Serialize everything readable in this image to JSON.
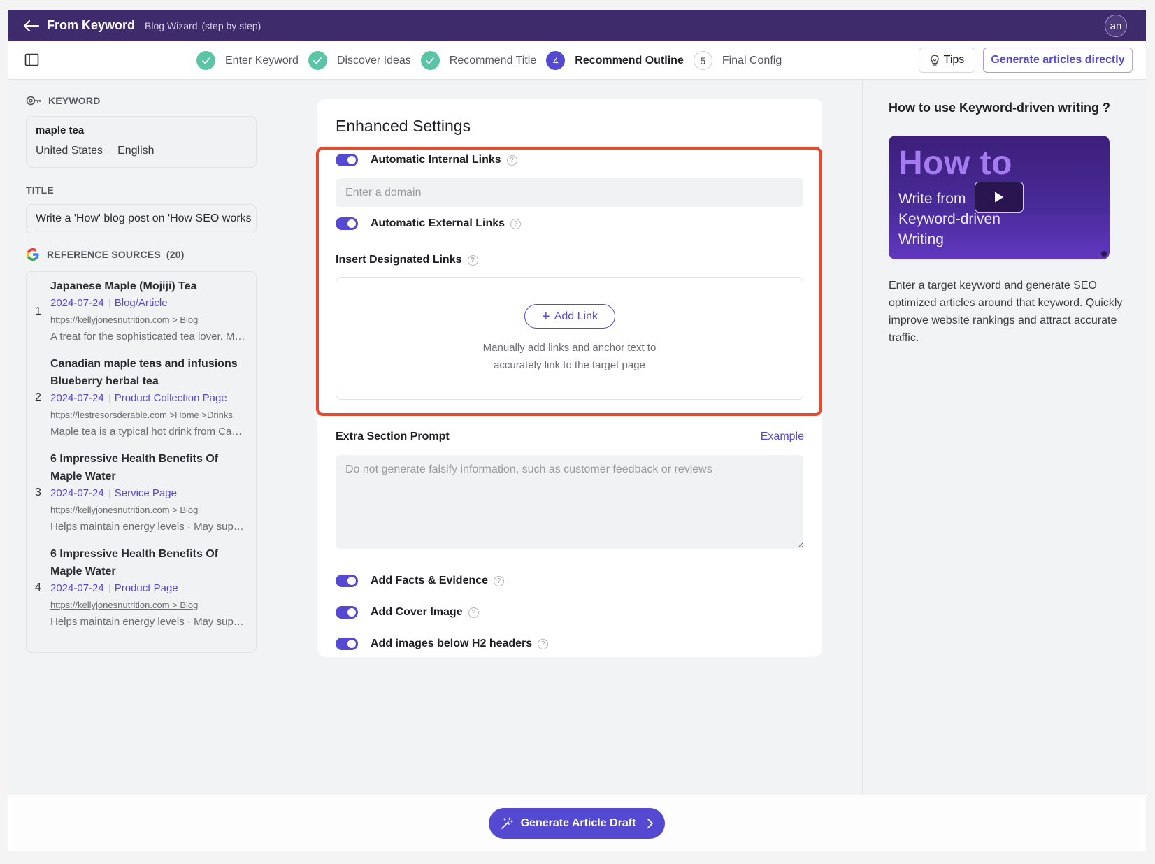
{
  "header": {
    "title": "From Keyword",
    "subtitle": "Blog Wizard",
    "subtitle_note": "(step by step)",
    "avatar_initials": "an"
  },
  "steps": [
    {
      "number": "1",
      "label": "Enter Keyword",
      "status": "done"
    },
    {
      "number": "2",
      "label": "Discover Ideas",
      "status": "done"
    },
    {
      "number": "3",
      "label": "Recommend Title",
      "status": "done"
    },
    {
      "number": "4",
      "label": "Recommend Outline",
      "status": "active"
    },
    {
      "number": "5",
      "label": "Final Config",
      "status": "todo"
    }
  ],
  "toolbar": {
    "tips_label": "Tips",
    "generate_directly_label": "Generate articles directly"
  },
  "left": {
    "keyword_heading": "KEYWORD",
    "keyword": "maple tea",
    "country": "United States",
    "language": "English",
    "title_heading": "TITLE",
    "title_value": "Write a 'How' blog post on 'How SEO works",
    "references_heading": "REFERENCE SOURCES",
    "references_count": "(20)",
    "references": [
      {
        "num": "1",
        "title": "Japanese Maple (Mojiji) Tea",
        "date": "2024-07-24",
        "type": "Blog/Article",
        "url": "https://kellyjonesnutrition.com > Blog",
        "desc": "A treat for the sophisticated tea lover. Ma..."
      },
      {
        "num": "2",
        "title": "Canadian maple teas and infusions Blueberry herbal tea",
        "date": "2024-07-24",
        "type": "Product Collection Page",
        "url": "https://lestresorsderable.com >Home >Drinks",
        "desc": "Maple tea is a typical hot drink from Cana..."
      },
      {
        "num": "3",
        "title": "6 Impressive Health Benefits Of Maple Water",
        "date": "2024-07-24",
        "type": "Service Page",
        "url": "https://kellyjonesnutrition.com > Blog",
        "desc": "Helps maintain energy levels · May suppo..."
      },
      {
        "num": "4",
        "title": "6 Impressive Health Benefits Of Maple Water",
        "date": "2024-07-24",
        "type": "Product Page",
        "url": "https://kellyjonesnutrition.com > Blog",
        "desc": "Helps maintain energy levels · May suppo..."
      }
    ]
  },
  "main": {
    "heading": "Enhanced Settings",
    "internal_links": {
      "label": "Automatic Internal Links",
      "on": true
    },
    "domain_placeholder": "Enter a domain",
    "domain_value": "",
    "external_links": {
      "label": "Automatic External Links",
      "on": true
    },
    "designated_links_label": "Insert Designated Links",
    "add_link_label": "Add Link",
    "add_link_help_line1": "Manually add links and anchor text to",
    "add_link_help_line2": "accurately link to the target page",
    "extra_prompt_label": "Extra Section Prompt",
    "example_label": "Example",
    "extra_prompt_placeholder": "Do not generate falsify information, such as customer feedback or reviews",
    "extra_prompt_value": "",
    "toggles": [
      {
        "label": "Add Facts & Evidence",
        "on": true
      },
      {
        "label": "Add Cover Image",
        "on": true
      },
      {
        "label": "Add images below H2 headers",
        "on": true
      }
    ]
  },
  "right": {
    "heading": "How to use Keyword-driven writing ?",
    "video_big_text": "How to",
    "video_line1": "Write from",
    "video_line2": "Keyword-driven",
    "video_line3": "Writing",
    "description": "Enter a target keyword and generate SEO optimized articles around that keyword. Quickly improve website rankings and attract accurate traffic."
  },
  "footer": {
    "generate_draft_label": "Generate Article Draft"
  },
  "colors": {
    "header_bg": "#3e2b6b",
    "accent": "#5548d1",
    "step_done": "#5cc4a6",
    "highlight_border": "#e84a2f"
  }
}
